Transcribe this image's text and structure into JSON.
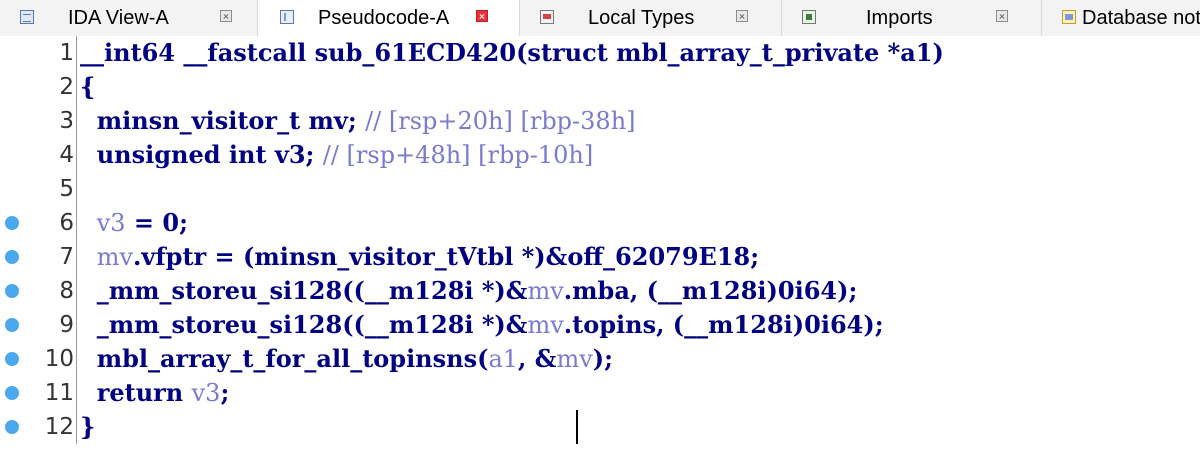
{
  "tabs": [
    {
      "label": "IDA View-A",
      "icon": "ida-view-icon",
      "active": false
    },
    {
      "label": "Pseudocode-A",
      "icon": "pseudocode-icon",
      "active": true
    },
    {
      "label": "Local Types",
      "icon": "local-types-icon",
      "active": false
    },
    {
      "label": "Imports",
      "icon": "imports-icon",
      "active": false
    },
    {
      "label": "Database notes",
      "icon": "database-notes-icon",
      "active": false
    }
  ],
  "editor": {
    "line_numbers": [
      "1",
      "2",
      "3",
      "4",
      "5",
      "6",
      "7",
      "8",
      "9",
      "10",
      "11",
      "12"
    ],
    "breakpoints": [
      "6",
      "7",
      "8",
      "9",
      "10",
      "11",
      "12"
    ],
    "lines": {
      "l1": [
        "__int64 __fastcall sub_61ECD420(struct mbl_array_t_private *a1)"
      ],
      "l2": [
        "{"
      ],
      "l3": [
        "  minsn_visitor_t mv; ",
        "// [rsp+20h] [rbp-38h]"
      ],
      "l4": [
        "  unsigned int v3; ",
        "// [rsp+48h] [rbp-10h]"
      ],
      "l5": [
        ""
      ],
      "l6": [
        "  ",
        "v3",
        " = 0;"
      ],
      "l7": [
        "  ",
        "mv",
        ".vfptr = (minsn_visitor_tVtbl *)&off_62079E18;"
      ],
      "l8": [
        "  _mm_storeu_si128((__m128i *)&",
        "mv",
        ".mba, (__m128i)0i64);"
      ],
      "l9": [
        "  _mm_storeu_si128((__m128i *)&",
        "mv",
        ".topins, (__m128i)0i64);"
      ],
      "l10": [
        "  mbl_array_t_for_all_topinsns(",
        "a1",
        ", &",
        "mv",
        ");"
      ],
      "l11": [
        "  return ",
        "v3",
        ";"
      ],
      "l12": [
        "}"
      ]
    }
  },
  "colors": {
    "keyword": "#000080",
    "variable": "#7a7acf",
    "comment": "#7a7acf",
    "breakpoint": "#4aa8ee",
    "close_active": "#e8333a"
  }
}
